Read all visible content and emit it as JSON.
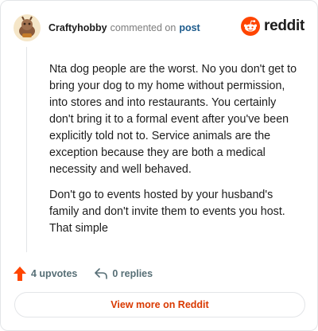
{
  "header": {
    "username": "Craftyhobby",
    "action": "commented on",
    "post_link": "post",
    "brand": "reddit"
  },
  "comment": {
    "paragraphs": [
      "Nta dog people are the worst. No you don't get to bring your dog to my home without permission, into stores and into restaurants. You certainly don't bring it to a formal event after you've been explicitly told not to. Service animals are the exception because they are both a medical necessity and well behaved.",
      "Don't go to events hosted by your husband's family and don't invite them to events you host. That simple"
    ]
  },
  "footer": {
    "upvotes": "4 upvotes",
    "replies": "0 replies",
    "view_more": "View more on Reddit"
  },
  "colors": {
    "accent": "#ff4500",
    "link": "#1d5b8c",
    "button_text": "#d93900"
  },
  "icons": {
    "avatar": "snoo-avatar-icon",
    "brand": "reddit-logo-icon",
    "upvote": "upvote-arrow-icon",
    "reply": "reply-arrow-icon"
  }
}
